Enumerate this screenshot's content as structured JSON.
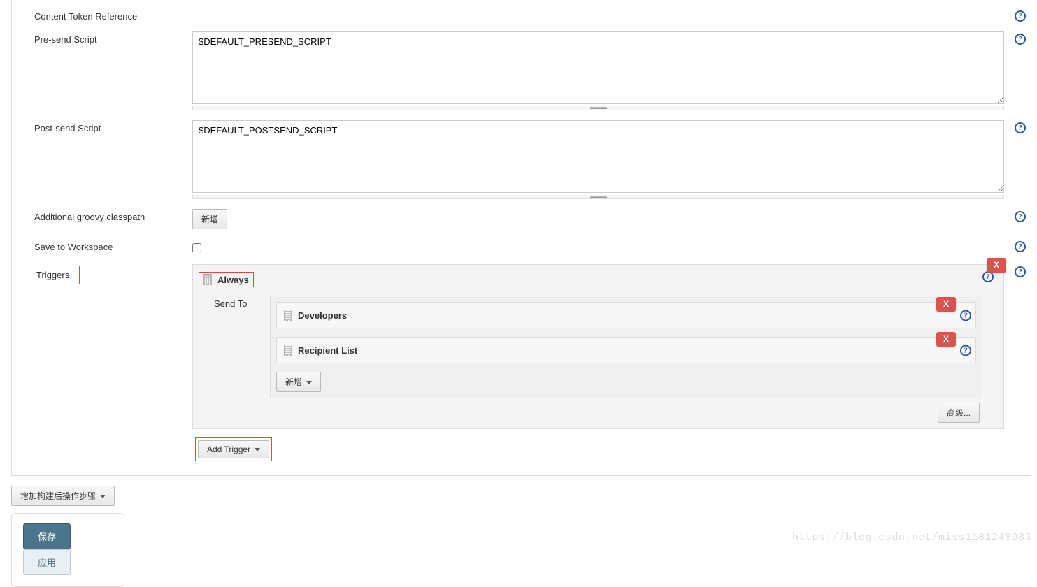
{
  "labels": {
    "content_token_reference": "Content Token Reference",
    "pre_send_script": "Pre-send Script",
    "post_send_script": "Post-send Script",
    "additional_groovy_classpath": "Additional groovy classpath",
    "save_to_workspace": "Save to Workspace",
    "triggers": "Triggers"
  },
  "values": {
    "pre_send_script": "$DEFAULT_PRESEND_SCRIPT",
    "post_send_script": "$DEFAULT_POSTSEND_SCRIPT"
  },
  "buttons": {
    "add_classpath": "新增",
    "add_recipient": "新增",
    "advanced": "高级...",
    "add_trigger": "Add Trigger",
    "add_post_build": "增加构建后操作步骤",
    "save": "保存",
    "apply": "应用",
    "delete": "X"
  },
  "trigger": {
    "type": "Always",
    "send_to_label": "Send To",
    "recipients": [
      {
        "name": "Developers"
      },
      {
        "name": "Recipient List"
      }
    ]
  },
  "watermark": "https://blog.csdn.net/miss1181248983"
}
